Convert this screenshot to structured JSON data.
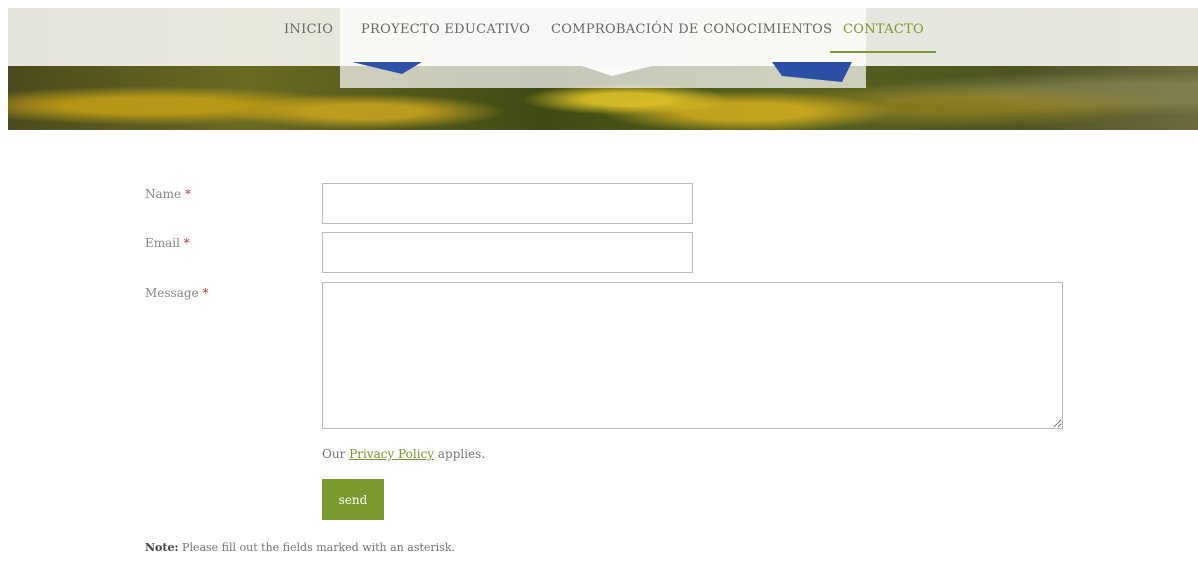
{
  "nav": {
    "items": [
      {
        "label": "INICIO"
      },
      {
        "label": "PROYECTO EDUCATIVO"
      },
      {
        "label": "COMPROBACIÓN DE CONOCIMIENTOS"
      },
      {
        "label": "CONTACTO",
        "active": true
      }
    ],
    "accent_color": "#7a9a2e"
  },
  "form": {
    "name": {
      "label": "Name",
      "required_mark": "*",
      "value": ""
    },
    "email": {
      "label": "Email",
      "required_mark": "*",
      "value": ""
    },
    "message": {
      "label": "Message",
      "required_mark": "*",
      "value": ""
    },
    "privacy": {
      "prefix": "Our",
      "link_text": "Privacy Policy",
      "suffix": "applies."
    },
    "send_label": "send"
  },
  "note": {
    "label": "Note:",
    "text": "Please fill out the fields marked with an asterisk."
  }
}
